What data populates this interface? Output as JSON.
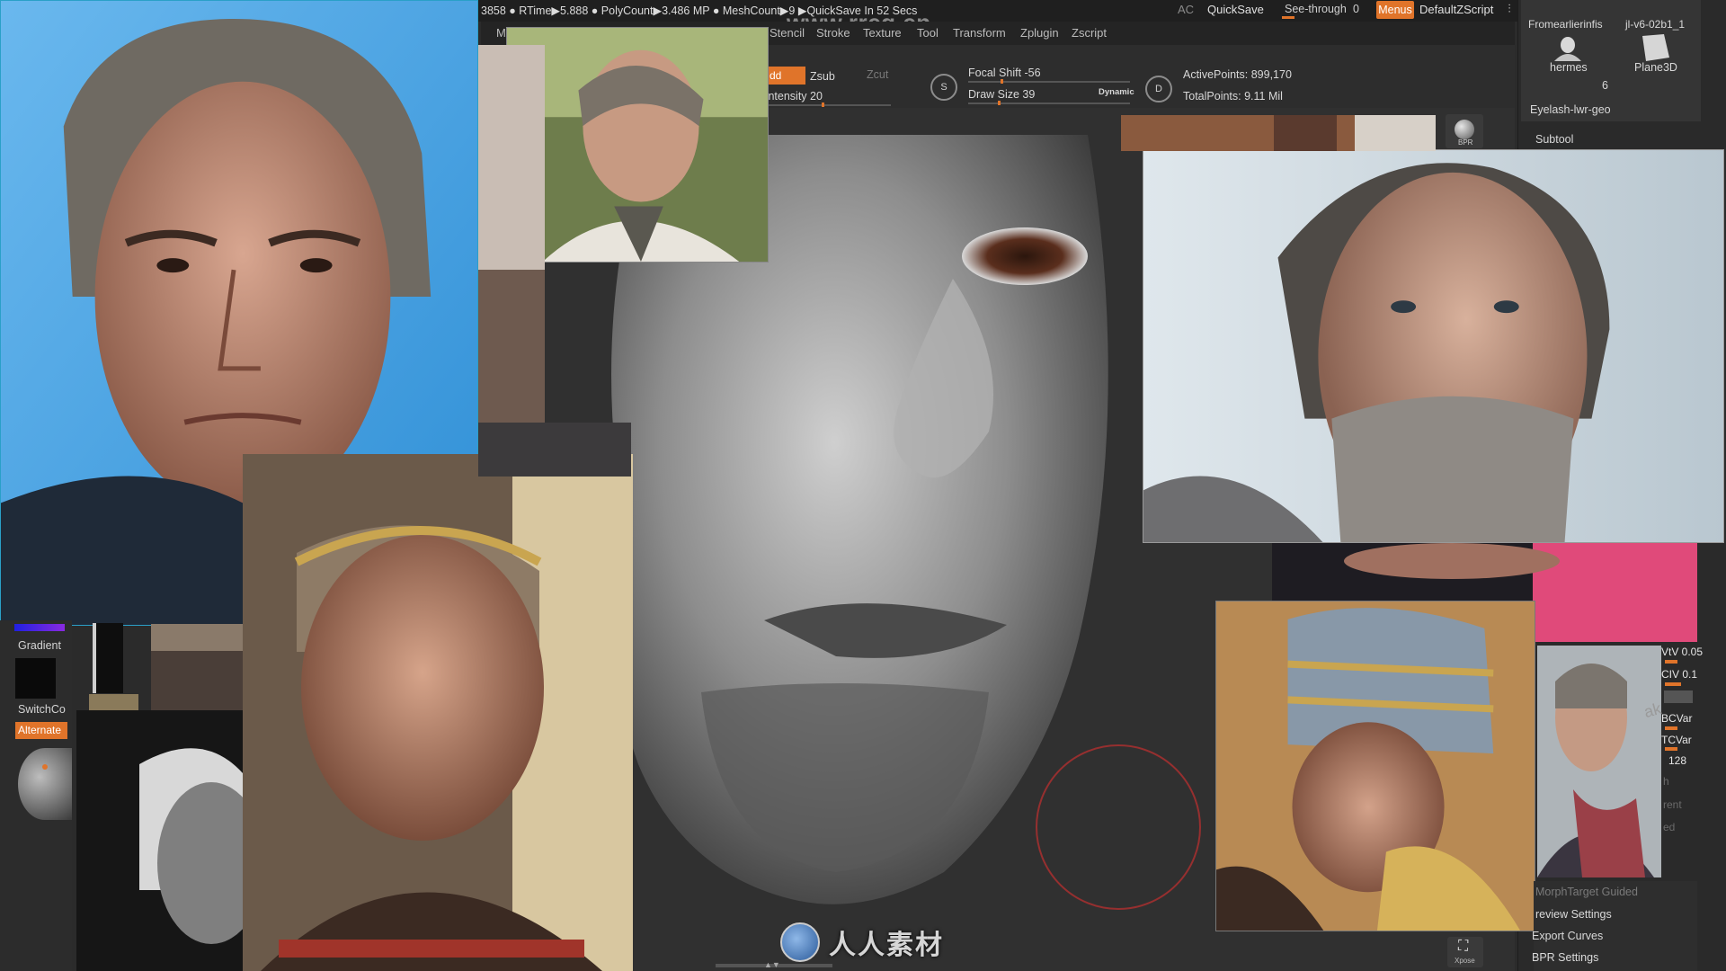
{
  "status_bar": {
    "text": "3858 ● RTime▶5.888 ● PolyCount▶3.486 MP ● MeshCount▶9 ▶QuickSave In 52 Secs",
    "watermark_url": "www.rrcg.cn"
  },
  "top_controls": {
    "ac": "AC",
    "quicksave": "QuickSave",
    "see_through_label": "See-through",
    "see_through_value": "0",
    "menus": "Menus",
    "default_zscript": "DefaultZScript"
  },
  "menu": {
    "items": [
      "Stencil",
      "Stroke",
      "Texture",
      "Tool",
      "Transform",
      "Zplugin",
      "Zscript"
    ],
    "cut_prefix": "M"
  },
  "toolbar": {
    "zadd": "dd",
    "zsub": "Zsub",
    "zcut": "Zcut",
    "intensity": "Intensity 20",
    "intensity_value": 20,
    "focal_shift": "Focal Shift -56",
    "draw_size": "Draw Size 39",
    "dynamic": "Dynamic",
    "active_points": "ActivePoints: 899,170",
    "total_points": "TotalPoints: 9.11 Mil",
    "s_icon": "S",
    "d_icon": "D"
  },
  "tool_panel": {
    "top_left_name": "Fromearlierinfis",
    "top_right_name": "jl-v6-02b1_1",
    "thumb1_label": "hermes",
    "thumb2_label": "Plane3D",
    "count": "6",
    "subtool_name": "Eyelash-lwr-geo",
    "subtool_header": "Subtool",
    "bpr_label": "BPR"
  },
  "left_shelf": {
    "gradient": "Gradient",
    "switch_color": "SwitchCo",
    "alternate": "Alternate"
  },
  "right_sliders": {
    "vtv": "VtV 0.05",
    "civ": "CIV 0.1",
    "bcvar": "BCVar",
    "tcvar": "TCVar",
    "value_128": "128",
    "faint1": "h",
    "faint2": "rent",
    "faint3": "ed",
    "ak": "ak"
  },
  "bottom_right_menu": {
    "morph": "MorphTarget Guided",
    "preview": "review Settings",
    "export": "Export Curves",
    "bpr": "BPR Settings"
  },
  "bottom": {
    "logo_text": "人人素材",
    "xpose": "Xpose"
  },
  "colors": {
    "accent": "#e0742a",
    "panel": "#2b2b2b",
    "bar": "#1f1f1f"
  }
}
